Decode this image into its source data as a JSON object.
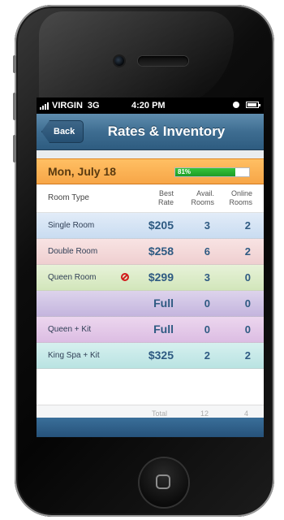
{
  "status_bar": {
    "carrier": "VIRGIN",
    "network": "3G",
    "time": "4:20 PM"
  },
  "nav": {
    "back_label": "Back",
    "title": "Rates & Inventory"
  },
  "date_bar": {
    "date": "Mon, July 18",
    "progress_label": "81%",
    "progress_value": 0.81
  },
  "columns": {
    "room_type": "Room Type",
    "best_rate_line1": "Best",
    "best_rate_line2": "Rate",
    "avail_line1": "Avail.",
    "avail_line2": "Rooms",
    "online_line1": "Online",
    "online_line2": "Rooms"
  },
  "rooms": [
    {
      "name": "Single Room",
      "rate": "$205",
      "avail": "3",
      "online": "2",
      "color": "#c9dcf1"
    },
    {
      "name": "Double Room",
      "rate": "$258",
      "avail": "6",
      "online": "2",
      "color": "#efcfd0"
    },
    {
      "name": "Queen Room",
      "rate": "$299",
      "avail": "3",
      "online": "0",
      "color": "#d2e6bb",
      "icon": "no-entry-icon"
    },
    {
      "name": "",
      "rate": "Full",
      "avail": "0",
      "online": "0",
      "color": "#c4b5de"
    },
    {
      "name": "Queen + Kit",
      "rate": "Full",
      "avail": "0",
      "online": "0",
      "color": "#dcbde3"
    },
    {
      "name": "King Spa + Kit",
      "rate": "$325",
      "avail": "2",
      "online": "2",
      "color": "#b9e3e2"
    }
  ],
  "totals": {
    "label": "Total",
    "avail": "12",
    "online": "4"
  }
}
